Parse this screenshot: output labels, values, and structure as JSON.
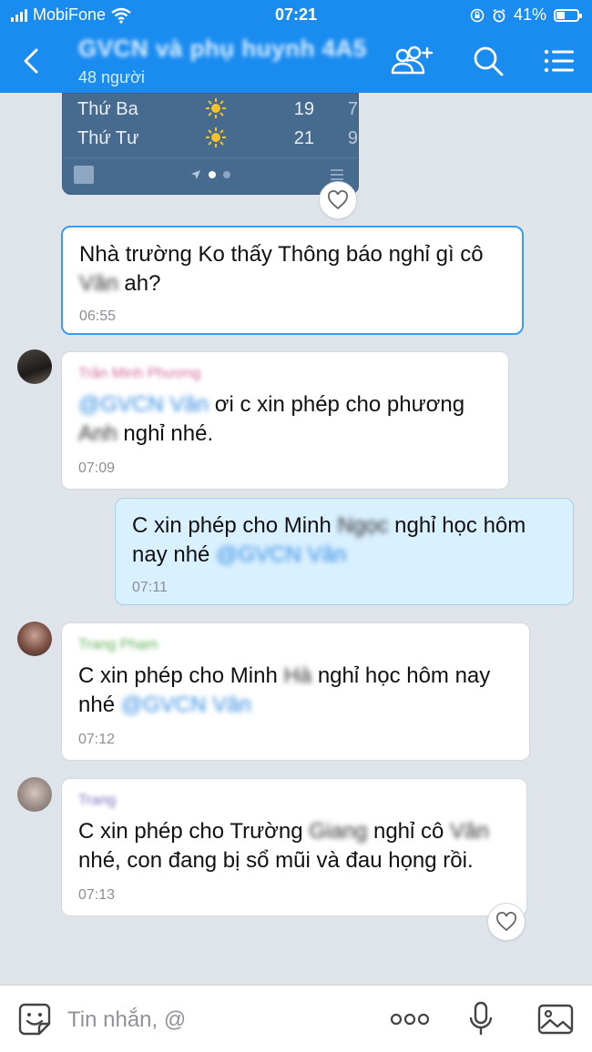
{
  "status_bar": {
    "carrier": "MobiFone",
    "time": "07:21",
    "battery": "41%"
  },
  "header": {
    "title": "GVCN và phụ huynh 4A5",
    "member_count": "48 người"
  },
  "weather": {
    "rows": [
      {
        "day": "Thứ Ba",
        "high": "19",
        "low": "7"
      },
      {
        "day": "Thứ Tư",
        "high": "21",
        "low": "9"
      }
    ]
  },
  "messages": [
    {
      "sender": "",
      "text_a": "Nhà trường Ko thấy Thông báo nghỉ gì cô ",
      "text_name": "Vân",
      "text_b": " ah?",
      "time": "06:55"
    },
    {
      "sender": "Trần Minh Phương",
      "tag": "@GVCN Vân",
      "text_a": " ơi c xin phép cho phương ",
      "text_name": "Anh",
      "text_b": " nghỉ nhé.",
      "time": "07:09"
    },
    {
      "sender": "",
      "text_a": "C xin phép cho Minh ",
      "text_name": "Ngọc",
      "text_b": " nghỉ học hôm nay nhé ",
      "tag": "@GVCN Vân",
      "time": "07:11"
    },
    {
      "sender": "Trang Phạm",
      "text_a": "C xin phép cho Minh ",
      "text_name": "Hà",
      "text_b": " nghỉ học hôm nay nhé ",
      "tag": "@GVCN Vân",
      "time": "07:12"
    },
    {
      "sender": "Trang",
      "text_a": "C xin phép cho Trường ",
      "text_name": "Giang",
      "text_b": " nghỉ cô ",
      "text_name2": "Vân",
      "text_c": " nhé, con đang bị sổ mũi và đau họng rồi.",
      "time": "07:13"
    }
  ],
  "composer": {
    "placeholder": "Tin nhắn, @"
  },
  "colors": {
    "brand": "#1a8cf0",
    "mine_bubble": "#d9f0ff",
    "background": "#dfe3ea"
  }
}
